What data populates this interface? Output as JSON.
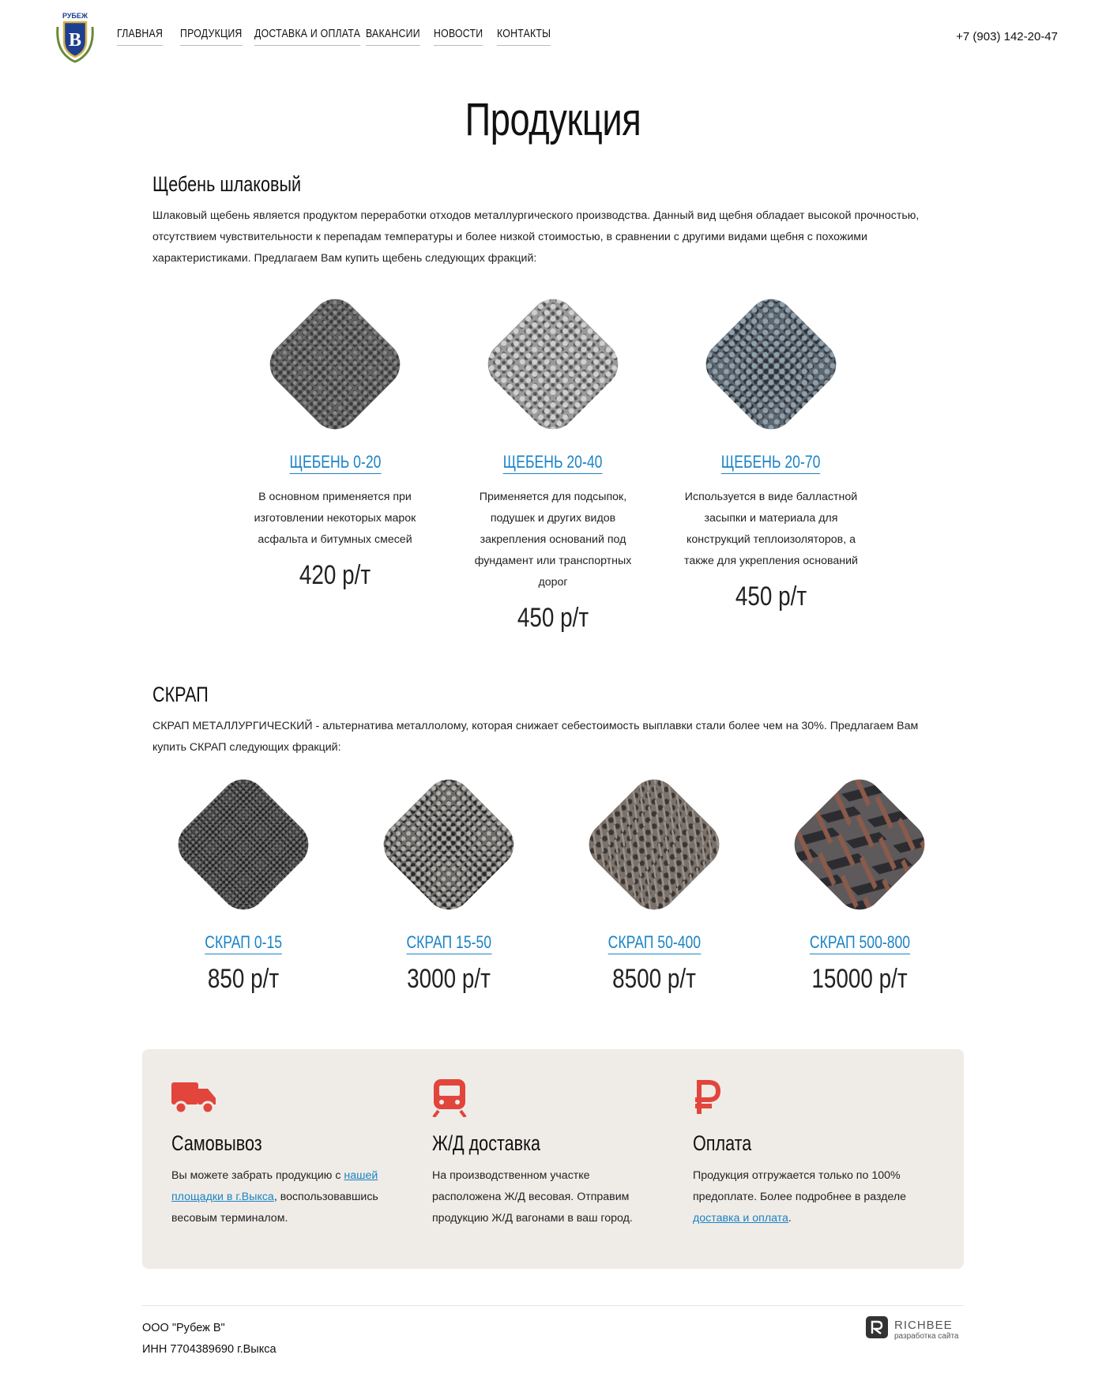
{
  "header": {
    "logo_text": "РУБЕЖ",
    "logo_letter": "В",
    "nav": [
      "ГЛАВНАЯ",
      "ПРОДУКЦИЯ",
      "ДОСТАВКА И ОПЛАТА",
      "ВАКАНСИИ",
      "НОВОСТИ",
      "КОНТАКТЫ"
    ],
    "phone": "+7 (903) 142-20-47"
  },
  "page_title": "Продукция",
  "section1": {
    "title": "Щебень шлаковый",
    "description": "Шлаковый щебень является продуктом переработки отходов металлургического производства. Данный вид щебня обладает высокой прочностью, отсутствием чувствительности к перепадам температуры и более низкой стоимостью, в сравнении с другими видами щебня с похожими характеристиками. Предлагаем Вам купить щебень следующих фракций:",
    "products": [
      {
        "name": "ЩЕБЕНЬ 0-20",
        "description": "В основном применяется при изготовлении некоторых марок асфальта и битумных смесей",
        "price": "420 р/т"
      },
      {
        "name": "ЩЕБЕНЬ 20-40",
        "description": "Применяется для подсыпок, подушек и других видов закрепления оснований под фундамент или транспортных дорог",
        "price": "450 р/т"
      },
      {
        "name": "ЩЕБЕНЬ 20-70",
        "description": "Используется в виде балластной засыпки и материала для конструкций теплоизоляторов, а также для укрепления оснований",
        "price": "450 р/т"
      }
    ]
  },
  "section2": {
    "title": "СКРАП",
    "description": "СКРАП МЕТАЛЛУРГИЧЕСКИЙ - альтернатива металлолому, которая снижает себестоимость выплавки стали более чем на 30%. Предлагаем Вам купить СКРАП следующих фракций:",
    "products": [
      {
        "name": "СКРАП 0-15",
        "price": "850 р/т"
      },
      {
        "name": "СКРАП 15-50",
        "price": "3000 р/т"
      },
      {
        "name": "СКРАП 50-400",
        "price": "8500 р/т"
      },
      {
        "name": "СКРАП 500-800",
        "price": "15000 р/т"
      }
    ]
  },
  "info": {
    "accent_color": "#e2453c",
    "cols": [
      {
        "icon": "truck-icon",
        "title": "Самовывоз",
        "text_before": "Вы можете забрать продукцию с ",
        "link": "нашей площадки в г.Выкса",
        "text_after": ", воспользовавшись весовым терминалом."
      },
      {
        "icon": "train-icon",
        "title": "Ж/Д доставка",
        "text_before": "На производственном участке расположена Ж/Д весовая. Отправим продукцию Ж/Д вагонами в ваш город.",
        "link": "",
        "text_after": ""
      },
      {
        "icon": "ruble-icon",
        "title": "Оплата",
        "text_before": "Продукция отгружается только по 100% предоплате. Более подробнее в разделе ",
        "link": "доставка и оплата",
        "text_after": "."
      }
    ]
  },
  "footer": {
    "org": "ООО \"Рубеж В\"",
    "inn": "ИНН 7704389690 г.Выкса",
    "dev_name": "RICHBEE",
    "dev_sub": "разработка сайта"
  }
}
